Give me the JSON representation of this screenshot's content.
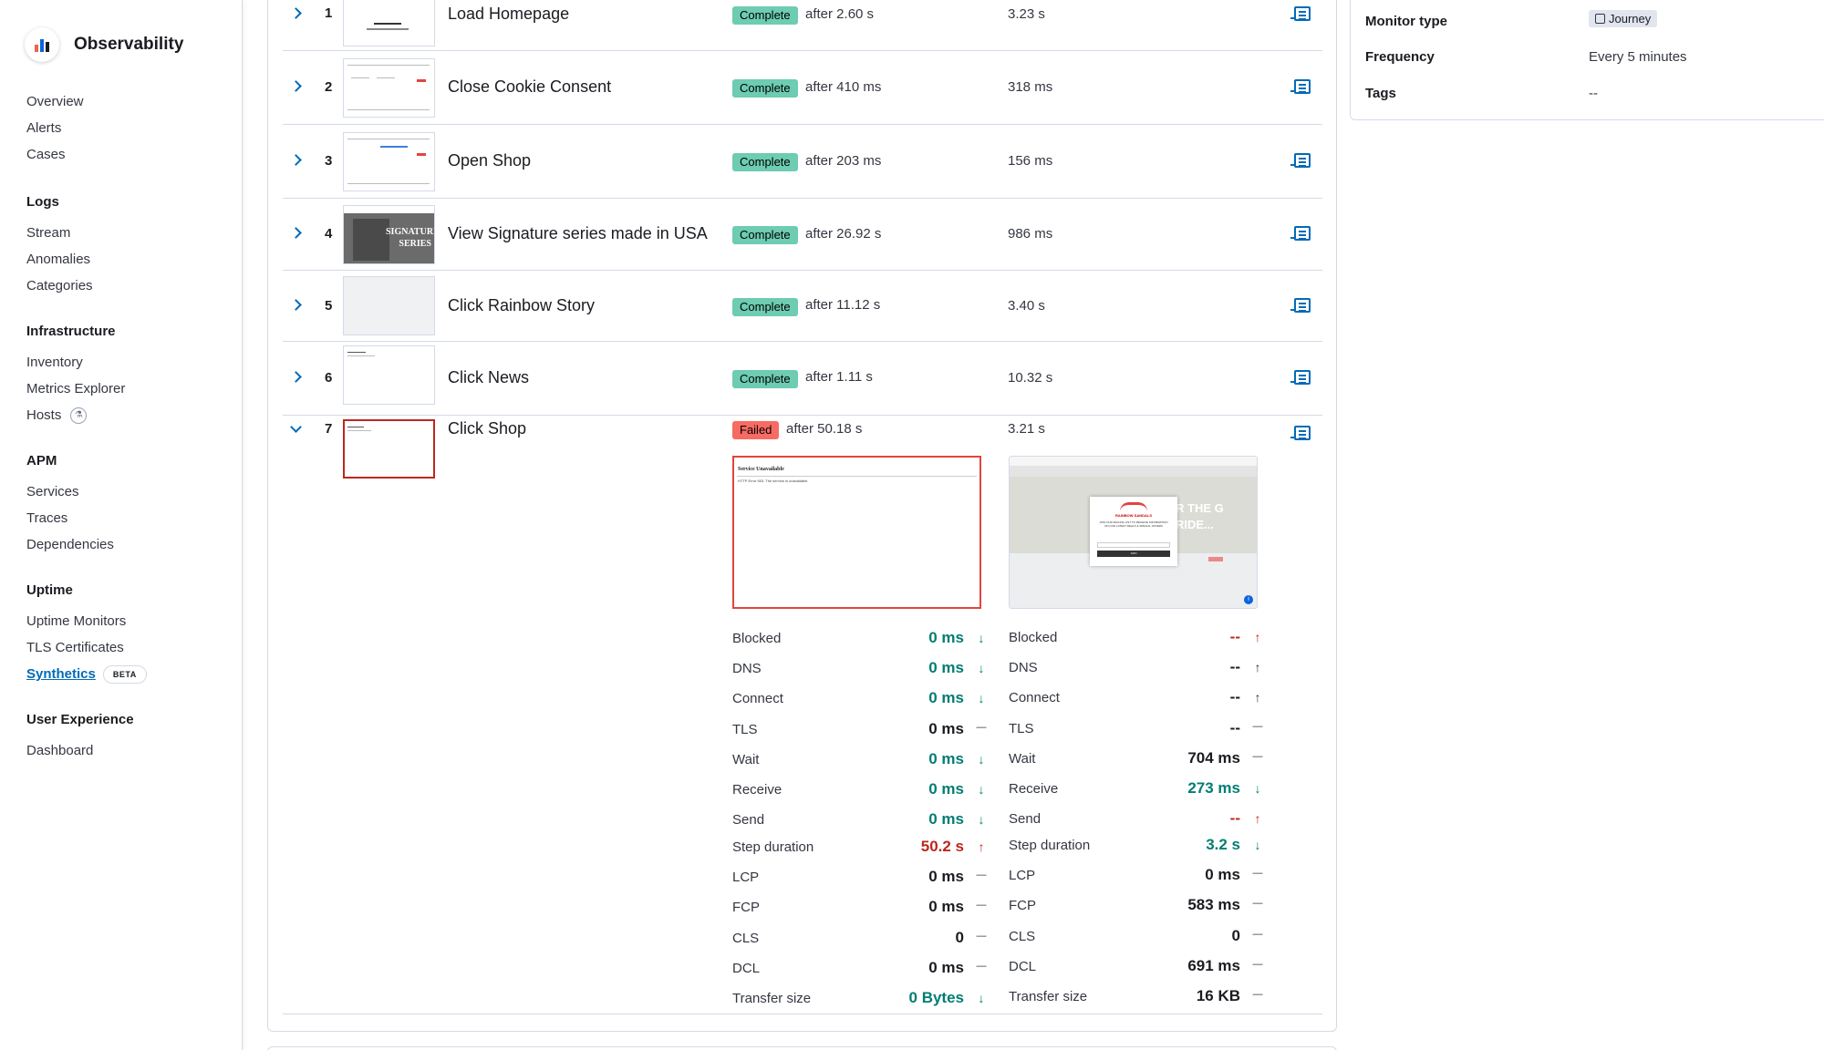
{
  "app": {
    "title": "Observability"
  },
  "sidebar": {
    "overview": "Overview",
    "alerts": "Alerts",
    "cases": "Cases",
    "logs": {
      "title": "Logs",
      "stream": "Stream",
      "anomalies": "Anomalies",
      "categories": "Categories"
    },
    "infrastructure": {
      "title": "Infrastructure",
      "inventory": "Inventory",
      "metrics_explorer": "Metrics Explorer",
      "hosts": "Hosts"
    },
    "apm": {
      "title": "APM",
      "services": "Services",
      "traces": "Traces",
      "dependencies": "Dependencies"
    },
    "uptime": {
      "title": "Uptime",
      "uptime_monitors": "Uptime Monitors",
      "tls_certificates": "TLS Certificates",
      "synthetics": "Synthetics",
      "beta": "BETA"
    },
    "user_experience": {
      "title": "User Experience",
      "dashboard": "Dashboard"
    }
  },
  "monitor": {
    "type_label": "Monitor type",
    "type_value": "Journey",
    "frequency_label": "Frequency",
    "frequency_value": "Every 5 minutes",
    "tags_label": "Tags",
    "tags_value": "--"
  },
  "steps": [
    {
      "num": "1",
      "name": "Load Homepage",
      "status": "Complete",
      "after": "after 2.60 s",
      "duration": "3.23 s"
    },
    {
      "num": "2",
      "name": "Close Cookie Consent",
      "status": "Complete",
      "after": "after 410 ms",
      "duration": "318 ms"
    },
    {
      "num": "3",
      "name": "Open Shop",
      "status": "Complete",
      "after": "after 203 ms",
      "duration": "156 ms"
    },
    {
      "num": "4",
      "name": "View Signature series made in USA",
      "status": "Complete",
      "after": "after 26.92 s",
      "duration": "986 ms"
    },
    {
      "num": "5",
      "name": "Click Rainbow Story",
      "status": "Complete",
      "after": "after 11.12 s",
      "duration": "3.40 s"
    },
    {
      "num": "6",
      "name": "Click News",
      "status": "Complete",
      "after": "after 1.11 s",
      "duration": "10.32 s"
    },
    {
      "num": "7",
      "name": "Click Shop",
      "status": "Failed",
      "after": "after 50.18 s",
      "duration": "3.21 s"
    }
  ],
  "thumb4_text": "SIGNATURE SERIES",
  "shot_left": {
    "title": "Service Unavailable",
    "body": "HTTP Error 503. The service is unavailable."
  },
  "shot_right": {
    "headline": "R THE G RIDE...",
    "brand": "RAINBOW SANDALS",
    "popup_text": "JOIN OUR MAILING LIST TO RECEIVE INFORMATION ON OUR LATEST DEALS & SPECIAL OFFERS",
    "join": "JOIN"
  },
  "metrics_left": [
    {
      "label": "Blocked",
      "value": "0 ms",
      "trend": "down"
    },
    {
      "label": "DNS",
      "value": "0 ms",
      "trend": "down"
    },
    {
      "label": "Connect",
      "value": "0 ms",
      "trend": "down"
    },
    {
      "label": "TLS",
      "value": "0 ms",
      "trend": "flat"
    },
    {
      "label": "Wait",
      "value": "0 ms",
      "trend": "down"
    },
    {
      "label": "Receive",
      "value": "0 ms",
      "trend": "down"
    },
    {
      "label": "Send",
      "value": "0 ms",
      "trend": "down"
    },
    {
      "label": "Step duration",
      "value": "50.2 s",
      "trend": "up"
    },
    {
      "label": "LCP",
      "value": "0 ms",
      "trend": "flat"
    },
    {
      "label": "FCP",
      "value": "0 ms",
      "trend": "flat"
    },
    {
      "label": "CLS",
      "value": "0",
      "trend": "flat"
    },
    {
      "label": "DCL",
      "value": "0 ms",
      "trend": "flat"
    },
    {
      "label": "Transfer size",
      "value": "0 Bytes",
      "trend": "down"
    }
  ],
  "metrics_right": [
    {
      "label": "Blocked",
      "value": "--",
      "trend": "up"
    },
    {
      "label": "DNS",
      "value": "--",
      "trend": "up-dark"
    },
    {
      "label": "Connect",
      "value": "--",
      "trend": "up-dark"
    },
    {
      "label": "TLS",
      "value": "--",
      "trend": "flat"
    },
    {
      "label": "Wait",
      "value": "704 ms",
      "trend": "flat"
    },
    {
      "label": "Receive",
      "value": "273 ms",
      "trend": "down"
    },
    {
      "label": "Send",
      "value": "--",
      "trend": "up"
    },
    {
      "label": "Step duration",
      "value": "3.2 s",
      "trend": "down"
    },
    {
      "label": "LCP",
      "value": "0 ms",
      "trend": "flat"
    },
    {
      "label": "FCP",
      "value": "583 ms",
      "trend": "flat"
    },
    {
      "label": "CLS",
      "value": "0",
      "trend": "flat"
    },
    {
      "label": "DCL",
      "value": "691 ms",
      "trend": "flat"
    },
    {
      "label": "Transfer size",
      "value": "16 KB",
      "trend": "flat"
    }
  ],
  "colors": {
    "complete": "#6dccb1",
    "failed": "#f86b63",
    "green": "#017d73",
    "red": "#bd271e",
    "link": "#006bb8"
  }
}
